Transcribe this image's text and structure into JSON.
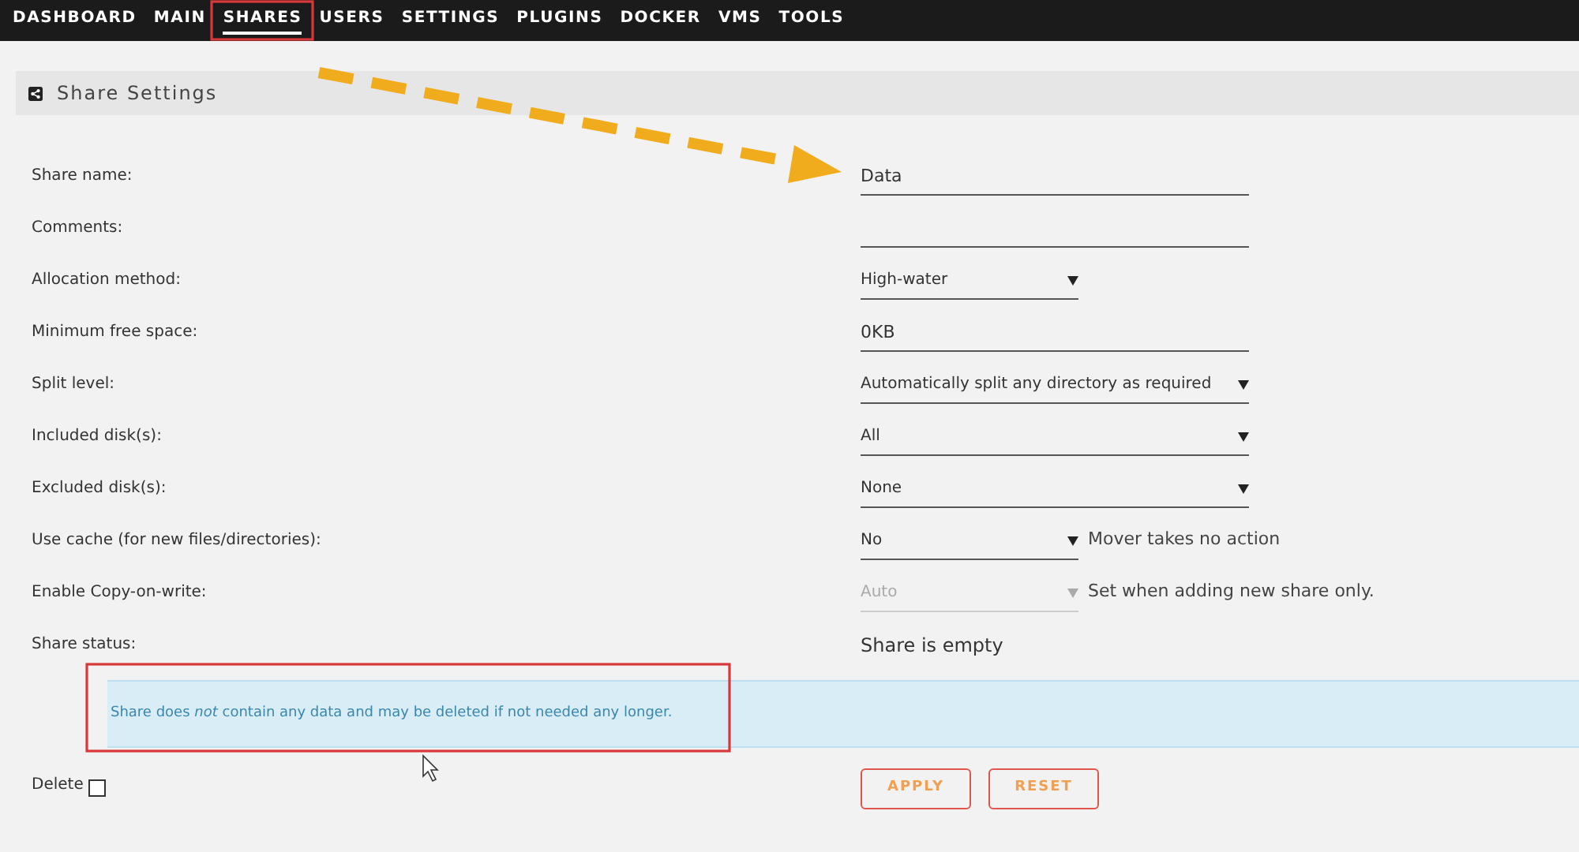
{
  "nav": [
    {
      "label": "DASHBOARD",
      "selected": false
    },
    {
      "label": "MAIN",
      "selected": false
    },
    {
      "label": "SHARES",
      "selected": true
    },
    {
      "label": "USERS",
      "selected": false
    },
    {
      "label": "SETTINGS",
      "selected": false
    },
    {
      "label": "PLUGINS",
      "selected": false
    },
    {
      "label": "DOCKER",
      "selected": false
    },
    {
      "label": "VMS",
      "selected": false
    },
    {
      "label": "TOOLS",
      "selected": false
    }
  ],
  "panel": {
    "title": "Share Settings"
  },
  "fields": [
    {
      "label": "Share name:",
      "kind": "input",
      "value": "Data"
    },
    {
      "label": "Comments:",
      "kind": "input"
    },
    {
      "label": "Allocation method:",
      "kind": "select-short",
      "value": "High-water",
      "disabled": false
    },
    {
      "label": "Minimum free space:",
      "kind": "input",
      "value": "0KB"
    },
    {
      "label": "Split level:",
      "kind": "select",
      "value": "Automatically split any directory as required",
      "disabled": false
    },
    {
      "label": "Included disk(s):",
      "kind": "select",
      "value": "All",
      "disabled": false
    },
    {
      "label": "Excluded disk(s):",
      "kind": "select",
      "value": "None",
      "disabled": false
    },
    {
      "label": "Use cache (for new files/directories):",
      "kind": "select-short",
      "value": "No",
      "note": "Mover takes no action",
      "disabled": false
    },
    {
      "label": "Enable Copy-on-write:",
      "kind": "select-short",
      "value": "Auto",
      "note": "Set when adding new share only.",
      "disabled": true
    },
    {
      "label": "Share status:",
      "kind": "status",
      "value": "Share is empty"
    }
  ],
  "notice": "Share does *not* contain any data and may be deleted if not needed any longer.",
  "delete": {
    "label": "Delete",
    "checked": false
  },
  "buttons": [
    "APPLY",
    "RESET"
  ]
}
